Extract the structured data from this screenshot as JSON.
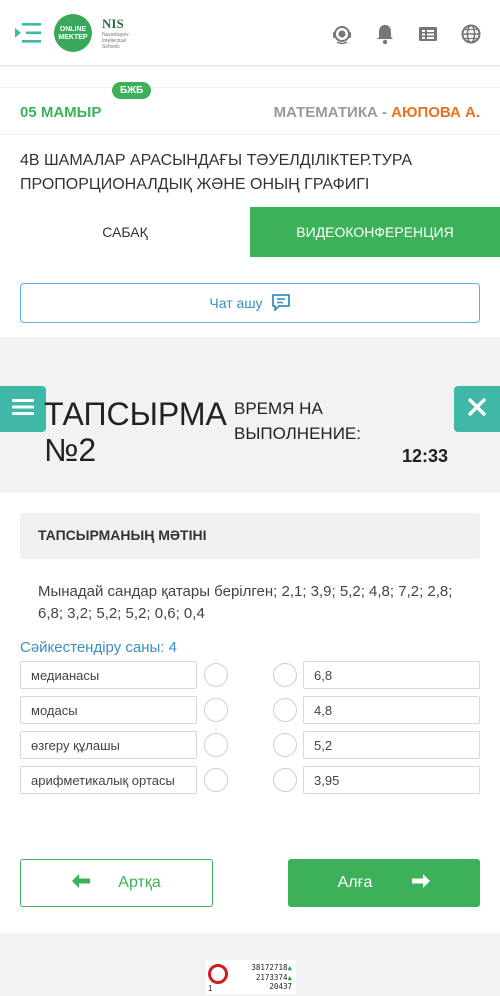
{
  "header": {
    "logo_text": "ONLINE MEKTEP",
    "nis_logo": "NIS",
    "nis_sub": "Nazarbayev Intellectual Schools",
    "icons": [
      "menu-toggle-icon",
      "support-icon",
      "bell-icon",
      "grades-icon",
      "globe-icon"
    ]
  },
  "lesson": {
    "date": "05 МАМЫР",
    "badge": "БЖБ",
    "subject": "МАТЕМАТИКА - ",
    "teacher": "АЮПОВА А.",
    "title": "4В ШАМАЛАР АРАСЫНДАҒЫ ТӘУЕЛДІЛІКТЕР.ТУРА ПРОПОРЦИОНАЛДЫҚ ЖӘНЕ ОНЫҢ ГРАФИГІ"
  },
  "tabs": {
    "lesson": "САБАҚ",
    "video": "ВИДЕОКОНФЕРЕНЦИЯ"
  },
  "chat": {
    "label": "Чат ашу"
  },
  "task": {
    "title": "ТАПСЫРМА №2",
    "time_label": "ВРЕМЯ НА ВЫПОЛНЕНИЕ:",
    "time_value": "12:33",
    "text_heading": "ТАПСЫРМАНЫҢ МӘТІНІ",
    "text": "Мынадай сандар қатары берілген; 2,1; 3,9; 5,2; 4,8; 7,2; 2,8; 6,8; 3,2; 5,2; 5,2; 0,6; 0,4",
    "match_count": "Сәйкестендіру саны: 4",
    "left_items": [
      "медианасы",
      "модасы",
      "өзгеру құлашы",
      "арифметикалық ортасы"
    ],
    "right_items": [
      "6,8",
      "4,8",
      "5,2",
      "3,95"
    ]
  },
  "nav": {
    "back": "Артқа",
    "next": "Алға"
  },
  "footer_ad": {
    "digit": "1",
    "lines": [
      "38172718",
      "2173374",
      "20437"
    ]
  },
  "colors": {
    "green": "#3cb15a",
    "orange": "#e8711f",
    "teal": "#3fb8a8",
    "blue": "#3a8fc0"
  }
}
